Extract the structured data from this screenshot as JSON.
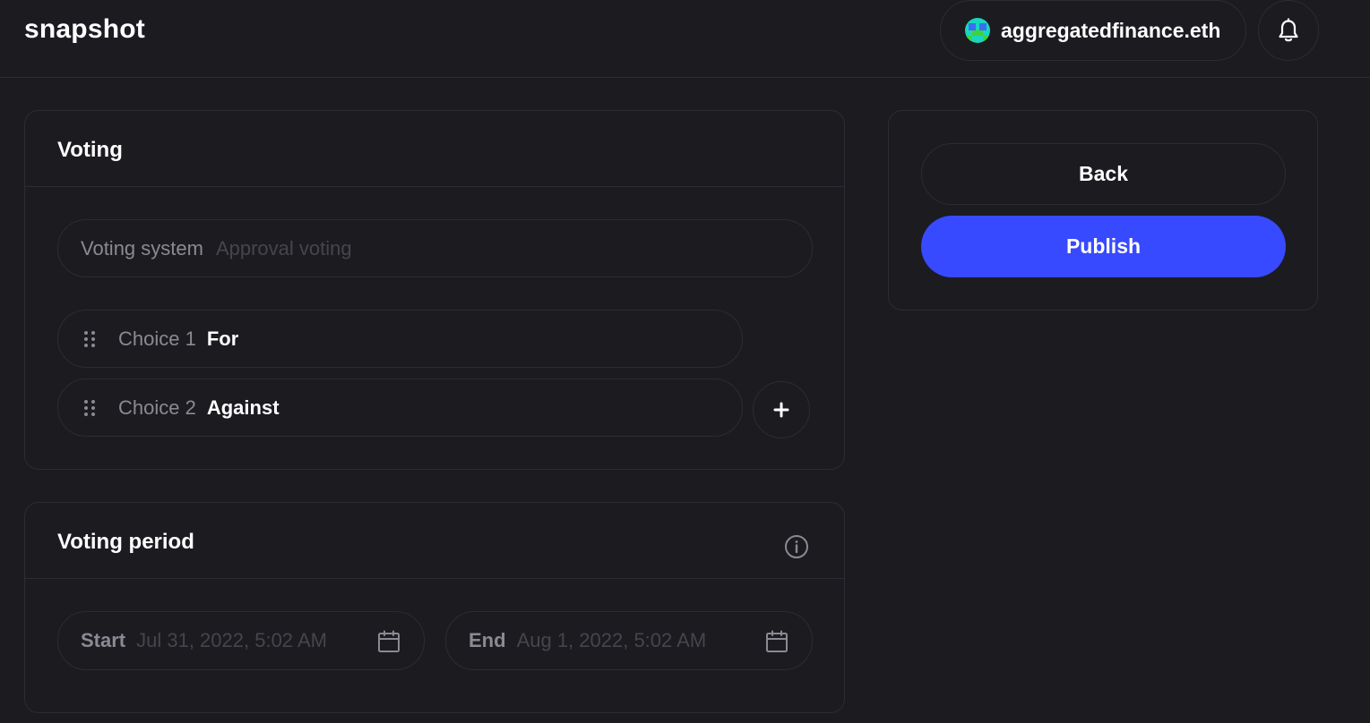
{
  "header": {
    "logo": "snapshot",
    "account": "aggregatedfinance.eth"
  },
  "voting": {
    "title": "Voting",
    "voting_system_label": "Voting system",
    "voting_system_value": "Approval voting",
    "choices": [
      {
        "label": "Choice 1",
        "value": "For"
      },
      {
        "label": "Choice 2",
        "value": "Against"
      }
    ]
  },
  "voting_period": {
    "title": "Voting period",
    "start_label": "Start",
    "start_value": "Jul 31, 2022, 5:02 AM",
    "end_label": "End",
    "end_value": "Aug 1, 2022, 5:02 AM"
  },
  "actions": {
    "back_label": "Back",
    "publish_label": "Publish"
  },
  "colors": {
    "background": "#1c1b20",
    "border": "#2d2c33",
    "accent": "#384aff",
    "muted_text": "#8b8a93"
  },
  "icons": [
    "bell-icon",
    "drag-handle-icon",
    "plus-icon",
    "info-icon",
    "calendar-icon"
  ]
}
